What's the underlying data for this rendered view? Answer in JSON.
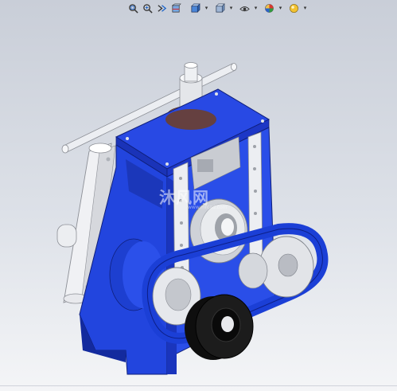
{
  "toolbar": {
    "buttons": [
      {
        "icon": "zoom-to-fit-icon",
        "has_dropdown": false
      },
      {
        "icon": "zoom-area-icon",
        "has_dropdown": false
      },
      {
        "icon": "previous-view-icon",
        "has_dropdown": false
      },
      {
        "icon": "section-view-icon",
        "has_dropdown": false
      },
      {
        "icon": "view-orientation-icon",
        "has_dropdown": true
      },
      {
        "icon": "display-style-icon",
        "has_dropdown": true
      },
      {
        "icon": "hide-show-items-icon",
        "has_dropdown": true
      },
      {
        "icon": "edit-appearance-icon",
        "has_dropdown": true
      },
      {
        "icon": "apply-scene-icon",
        "has_dropdown": true
      }
    ]
  },
  "watermark": {
    "text": "沐风网",
    "sub": "www.mfcad.com"
  },
  "colors": {
    "frame_blue": "#1f3fd6",
    "frame_dark": "#16289a",
    "steel": "#d9dbe0",
    "bronze": "#8a5a44",
    "black_roller": "#141414"
  }
}
